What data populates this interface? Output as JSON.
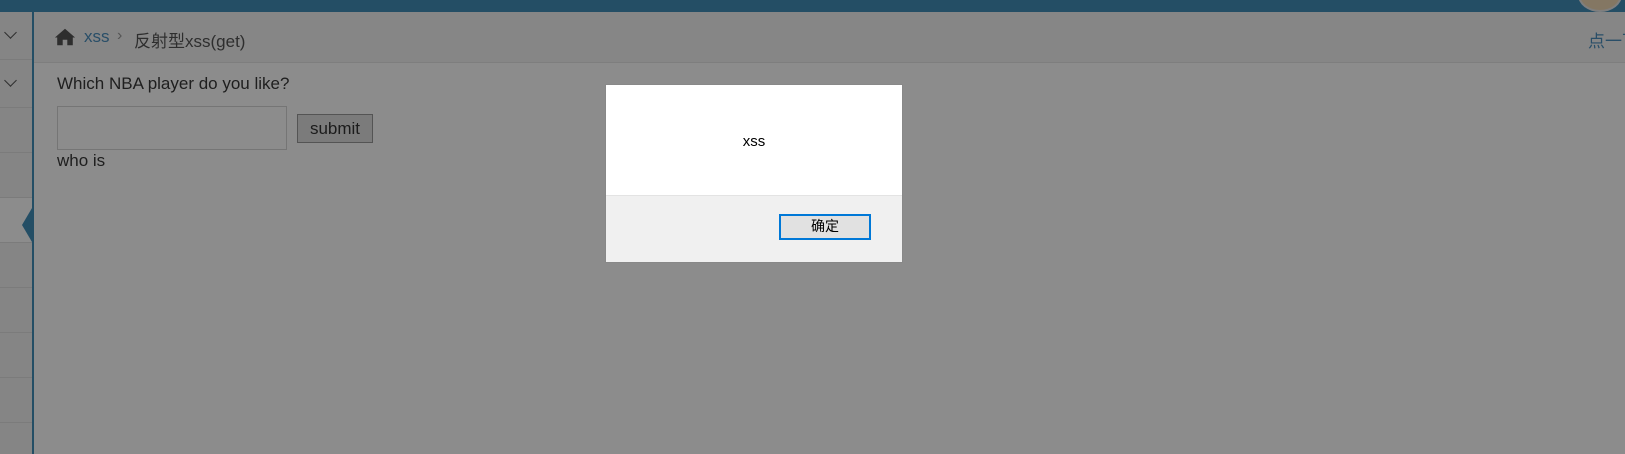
{
  "breadcrumb": {
    "home_icon": "home-icon",
    "link": "xss",
    "separator": "›",
    "current": "反射型xss(get)",
    "right_text": "点一下"
  },
  "form": {
    "question": "Which NBA player do you like?",
    "input_value": "",
    "submit_label": "submit",
    "result_text": "who is"
  },
  "alert": {
    "message": "xss",
    "ok_label": "确定"
  },
  "colors": {
    "accent": "#438eb9",
    "link": "#4c8fbd",
    "dialog_focus": "#0078d7"
  }
}
